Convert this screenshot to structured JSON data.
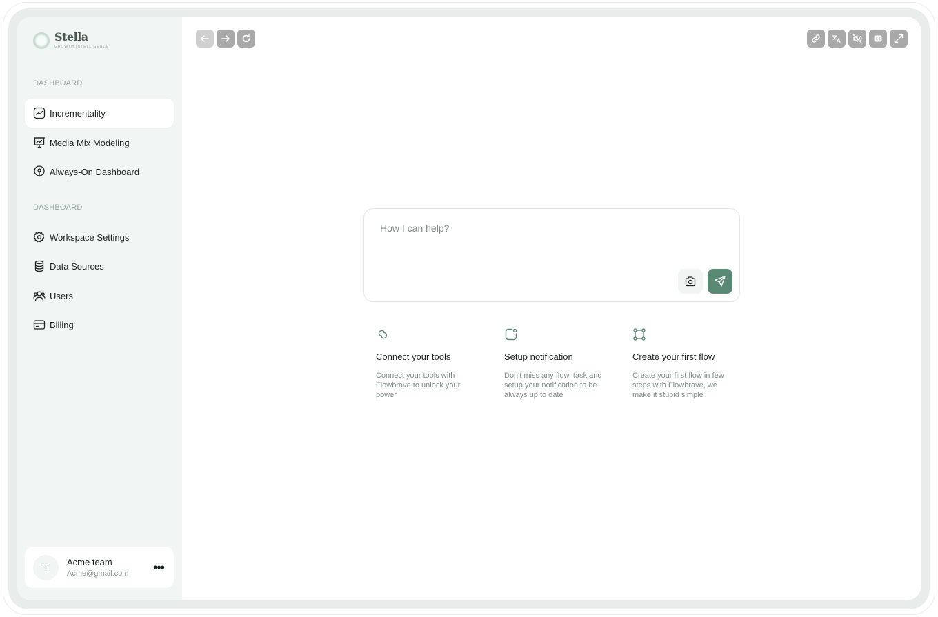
{
  "brand": {
    "name": "Stella",
    "tagline": "GROWTH INTELLIGENCE"
  },
  "sidebar": {
    "sections": [
      {
        "label": "DASHBOARD",
        "items": [
          {
            "label": "Incrementality",
            "icon": "trend-chart-icon",
            "active": true
          },
          {
            "label": "Media Mix Modeling",
            "icon": "presentation-chart-icon",
            "active": false
          },
          {
            "label": "Always-On Dashboard",
            "icon": "location-pin-icon",
            "active": false
          }
        ]
      },
      {
        "label": "DASHBOARD",
        "items": [
          {
            "label": "Workspace Settings",
            "icon": "gear-icon"
          },
          {
            "label": "Data Sources",
            "icon": "database-icon"
          },
          {
            "label": "Users",
            "icon": "users-icon"
          },
          {
            "label": "Billing",
            "icon": "credit-card-icon"
          }
        ]
      }
    ],
    "user": {
      "initial": "T",
      "name": "Acme team",
      "email": "Acme@gmail.com",
      "more": "•••"
    }
  },
  "toolbar": {
    "left": [
      "back-arrow-icon",
      "forward-arrow-icon",
      "reload-icon"
    ],
    "right": [
      "link-icon",
      "translate-icon",
      "mute-icon",
      "captions-icon",
      "fullscreen-icon"
    ]
  },
  "prompt": {
    "placeholder": "How I can help?"
  },
  "features": [
    {
      "icon": "link-chain-icon",
      "title": "Connect your tools",
      "desc": "Connect your tools with Flowbrave to unlock your power"
    },
    {
      "icon": "notification-icon",
      "title": "Setup notification",
      "desc": "Don't miss any flow, task and setup your notification to be always up to date"
    },
    {
      "icon": "flow-nodes-icon",
      "title": "Create your first flow",
      "desc": "Create your first flow in few steps with Flowbrave, we make it stupid simple"
    }
  ],
  "colors": {
    "accent": "#5b8a74",
    "sidebar_bg": "#f1f5f3",
    "toolbar_btn": "#a9a9a9"
  }
}
